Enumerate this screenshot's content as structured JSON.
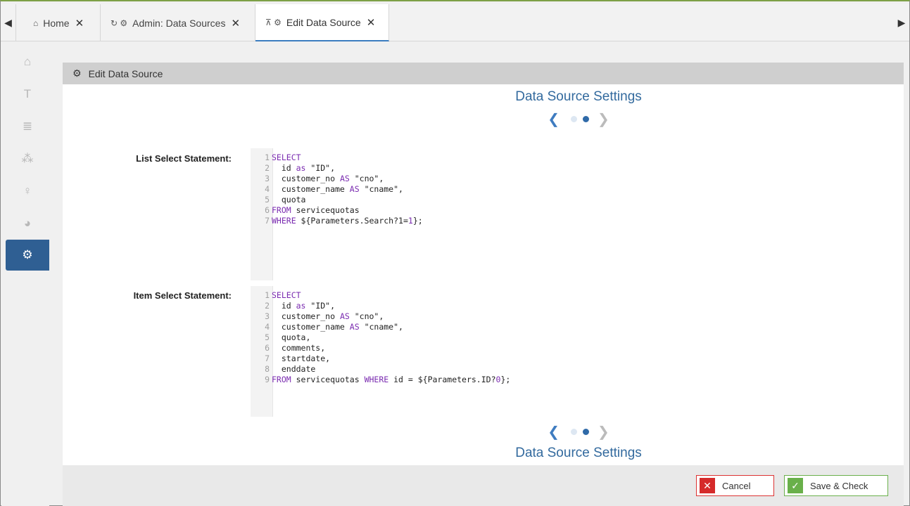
{
  "tabs": [
    {
      "icon": "home-icon",
      "glyph": "⌂",
      "label": "Home"
    },
    {
      "icon": "refresh-admin-icon",
      "glyph": "↻ ⚙",
      "label": "Admin: Data Sources"
    },
    {
      "icon": "pin-gear-icon",
      "glyph": "⊼ ⚙",
      "label": "Edit Data Source"
    }
  ],
  "tab_close_glyph": "✕",
  "sidebar": {
    "items": [
      {
        "icon": "home-icon",
        "glyph": "⌂"
      },
      {
        "icon": "text-icon",
        "glyph": "T"
      },
      {
        "icon": "database-icon",
        "glyph": "≣"
      },
      {
        "icon": "users-icon",
        "glyph": "⁂"
      },
      {
        "icon": "lightbulb-icon",
        "glyph": "♀"
      },
      {
        "icon": "pie-chart-icon",
        "glyph": "◕"
      },
      {
        "icon": "admin-users-gear-icon",
        "glyph": "⚙"
      }
    ]
  },
  "panel": {
    "title": "Edit Data Source",
    "section_title": "Data Source Settings",
    "pager_left": "❮",
    "pager_right": "❯"
  },
  "fields": {
    "list_select": {
      "label": "List Select Statement:",
      "lines": [
        [
          {
            "t": "SELECT",
            "k": true
          }
        ],
        [
          {
            "t": "  id ",
            "k": false
          },
          {
            "t": "as",
            "k": true
          },
          {
            "t": " \"ID\",",
            "k": false
          }
        ],
        [
          {
            "t": "  customer_no ",
            "k": false
          },
          {
            "t": "AS",
            "k": true
          },
          {
            "t": " \"cno\",",
            "k": false
          }
        ],
        [
          {
            "t": "  customer_name ",
            "k": false
          },
          {
            "t": "AS",
            "k": true
          },
          {
            "t": " \"cname\",",
            "k": false
          }
        ],
        [
          {
            "t": "  quota",
            "k": false
          }
        ],
        [
          {
            "t": "FROM",
            "k": true
          },
          {
            "t": " servicequotas",
            "k": false
          }
        ],
        [
          {
            "t": "WHERE",
            "k": true
          },
          {
            "t": " ${Parameters.Search?1=",
            "k": false
          },
          {
            "t": "1",
            "k": true
          },
          {
            "t": "};",
            "k": false
          }
        ]
      ]
    },
    "item_select": {
      "label": "Item Select Statement:",
      "lines": [
        [
          {
            "t": "SELECT",
            "k": true
          }
        ],
        [
          {
            "t": "  id ",
            "k": false
          },
          {
            "t": "as",
            "k": true
          },
          {
            "t": " \"ID\",",
            "k": false
          }
        ],
        [
          {
            "t": "  customer_no ",
            "k": false
          },
          {
            "t": "AS",
            "k": true
          },
          {
            "t": " \"cno\",",
            "k": false
          }
        ],
        [
          {
            "t": "  customer_name ",
            "k": false
          },
          {
            "t": "AS",
            "k": true
          },
          {
            "t": " \"cname\",",
            "k": false
          }
        ],
        [
          {
            "t": "  quota,",
            "k": false
          }
        ],
        [
          {
            "t": "  comments,",
            "k": false
          }
        ],
        [
          {
            "t": "  startdate,",
            "k": false
          }
        ],
        [
          {
            "t": "  enddate",
            "k": false
          }
        ],
        [
          {
            "t": "FROM",
            "k": true
          },
          {
            "t": " servicequotas ",
            "k": false
          },
          {
            "t": "WHERE",
            "k": true
          },
          {
            "t": " id = ${Parameters.ID?",
            "k": false
          },
          {
            "t": "0",
            "k": true
          },
          {
            "t": "};",
            "k": false
          }
        ]
      ]
    }
  },
  "buttons": {
    "cancel": {
      "label": "Cancel",
      "icon": "close-icon",
      "glyph": "✕"
    },
    "save": {
      "label": "Save & Check",
      "icon": "check-icon",
      "glyph": "✓"
    }
  },
  "colors": {
    "accent": "#2f5f93",
    "title": "#336a9e",
    "keyword": "#7a2bb0",
    "cancel": "#d52a2a",
    "save": "#69b04a"
  }
}
